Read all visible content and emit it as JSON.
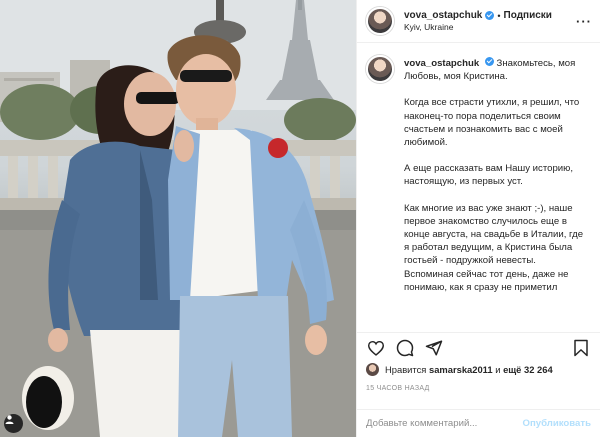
{
  "post": {
    "username": "vova_ostapchuk",
    "follow_label": "Подписки",
    "location": "Kyiv, Ukraine",
    "more_icon": "more-horizontal-icon",
    "caption_lead": "Знакомьтесь, моя Любовь, моя Кристина.",
    "caption_paragraphs": [
      "Когда все страсти утихли, я решил, что наконец-то пора поделиться своим счастьем и познакомить вас с моей любимой.",
      "А еще рассказать вам Нашу историю, настоящую, из первых уст.",
      "Как многие из вас уже знают ;-), наше первое знакомство случилось еще в конце августа, на свадьбе в Италии, где я работал ведущим, а Кристина была гостьей - подружкой невесты.",
      "Вспоминая сейчас тот день, даже не понимаю, как я сразу не приметил"
    ]
  },
  "actions": {
    "icons": [
      "heart-icon",
      "comment-icon",
      "share-icon",
      "bookmark-icon"
    ]
  },
  "likes": {
    "prefix": "Нравится",
    "liker": "samarska2011",
    "middle": "и",
    "others": "ещё 32 264"
  },
  "timestamp": "15 часов назад",
  "comment_box": {
    "placeholder": "Добавьте комментарий...",
    "publish_label": "Опубликовать"
  },
  "colors": {
    "verified": "#3897f0",
    "publish_disabled": "#b2dffc",
    "muted": "#8e8e8e"
  }
}
